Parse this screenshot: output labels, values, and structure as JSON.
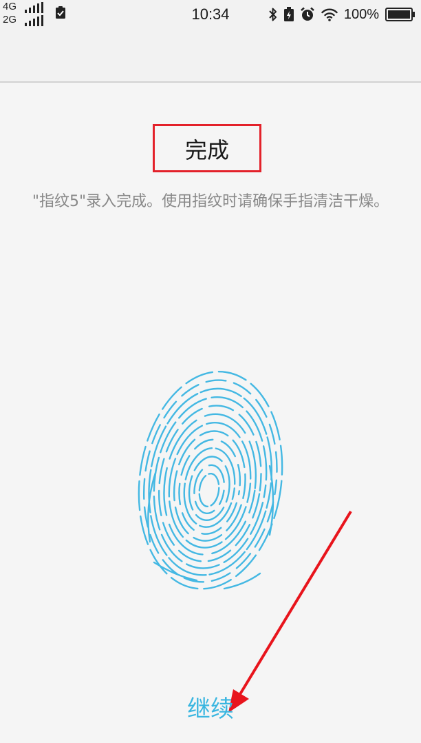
{
  "status_bar": {
    "network_1": "4G",
    "network_2": "2G",
    "time": "10:34",
    "battery_percent": "100%",
    "icons": [
      "signal-icon",
      "clipboard-check-icon",
      "bluetooth-icon",
      "battery-saver-icon",
      "alarm-icon",
      "wifi-icon",
      "battery-icon"
    ]
  },
  "main": {
    "title": "完成",
    "subtitle": "\"指纹5\"录入完成。使用指纹时请确保手指清洁干燥。",
    "fingerprint_icon": "fingerprint-icon",
    "continue_label": "继续"
  },
  "colors": {
    "accent": "#3ab6e0",
    "highlight_box": "#e3212a",
    "arrow": "#e8141c"
  }
}
